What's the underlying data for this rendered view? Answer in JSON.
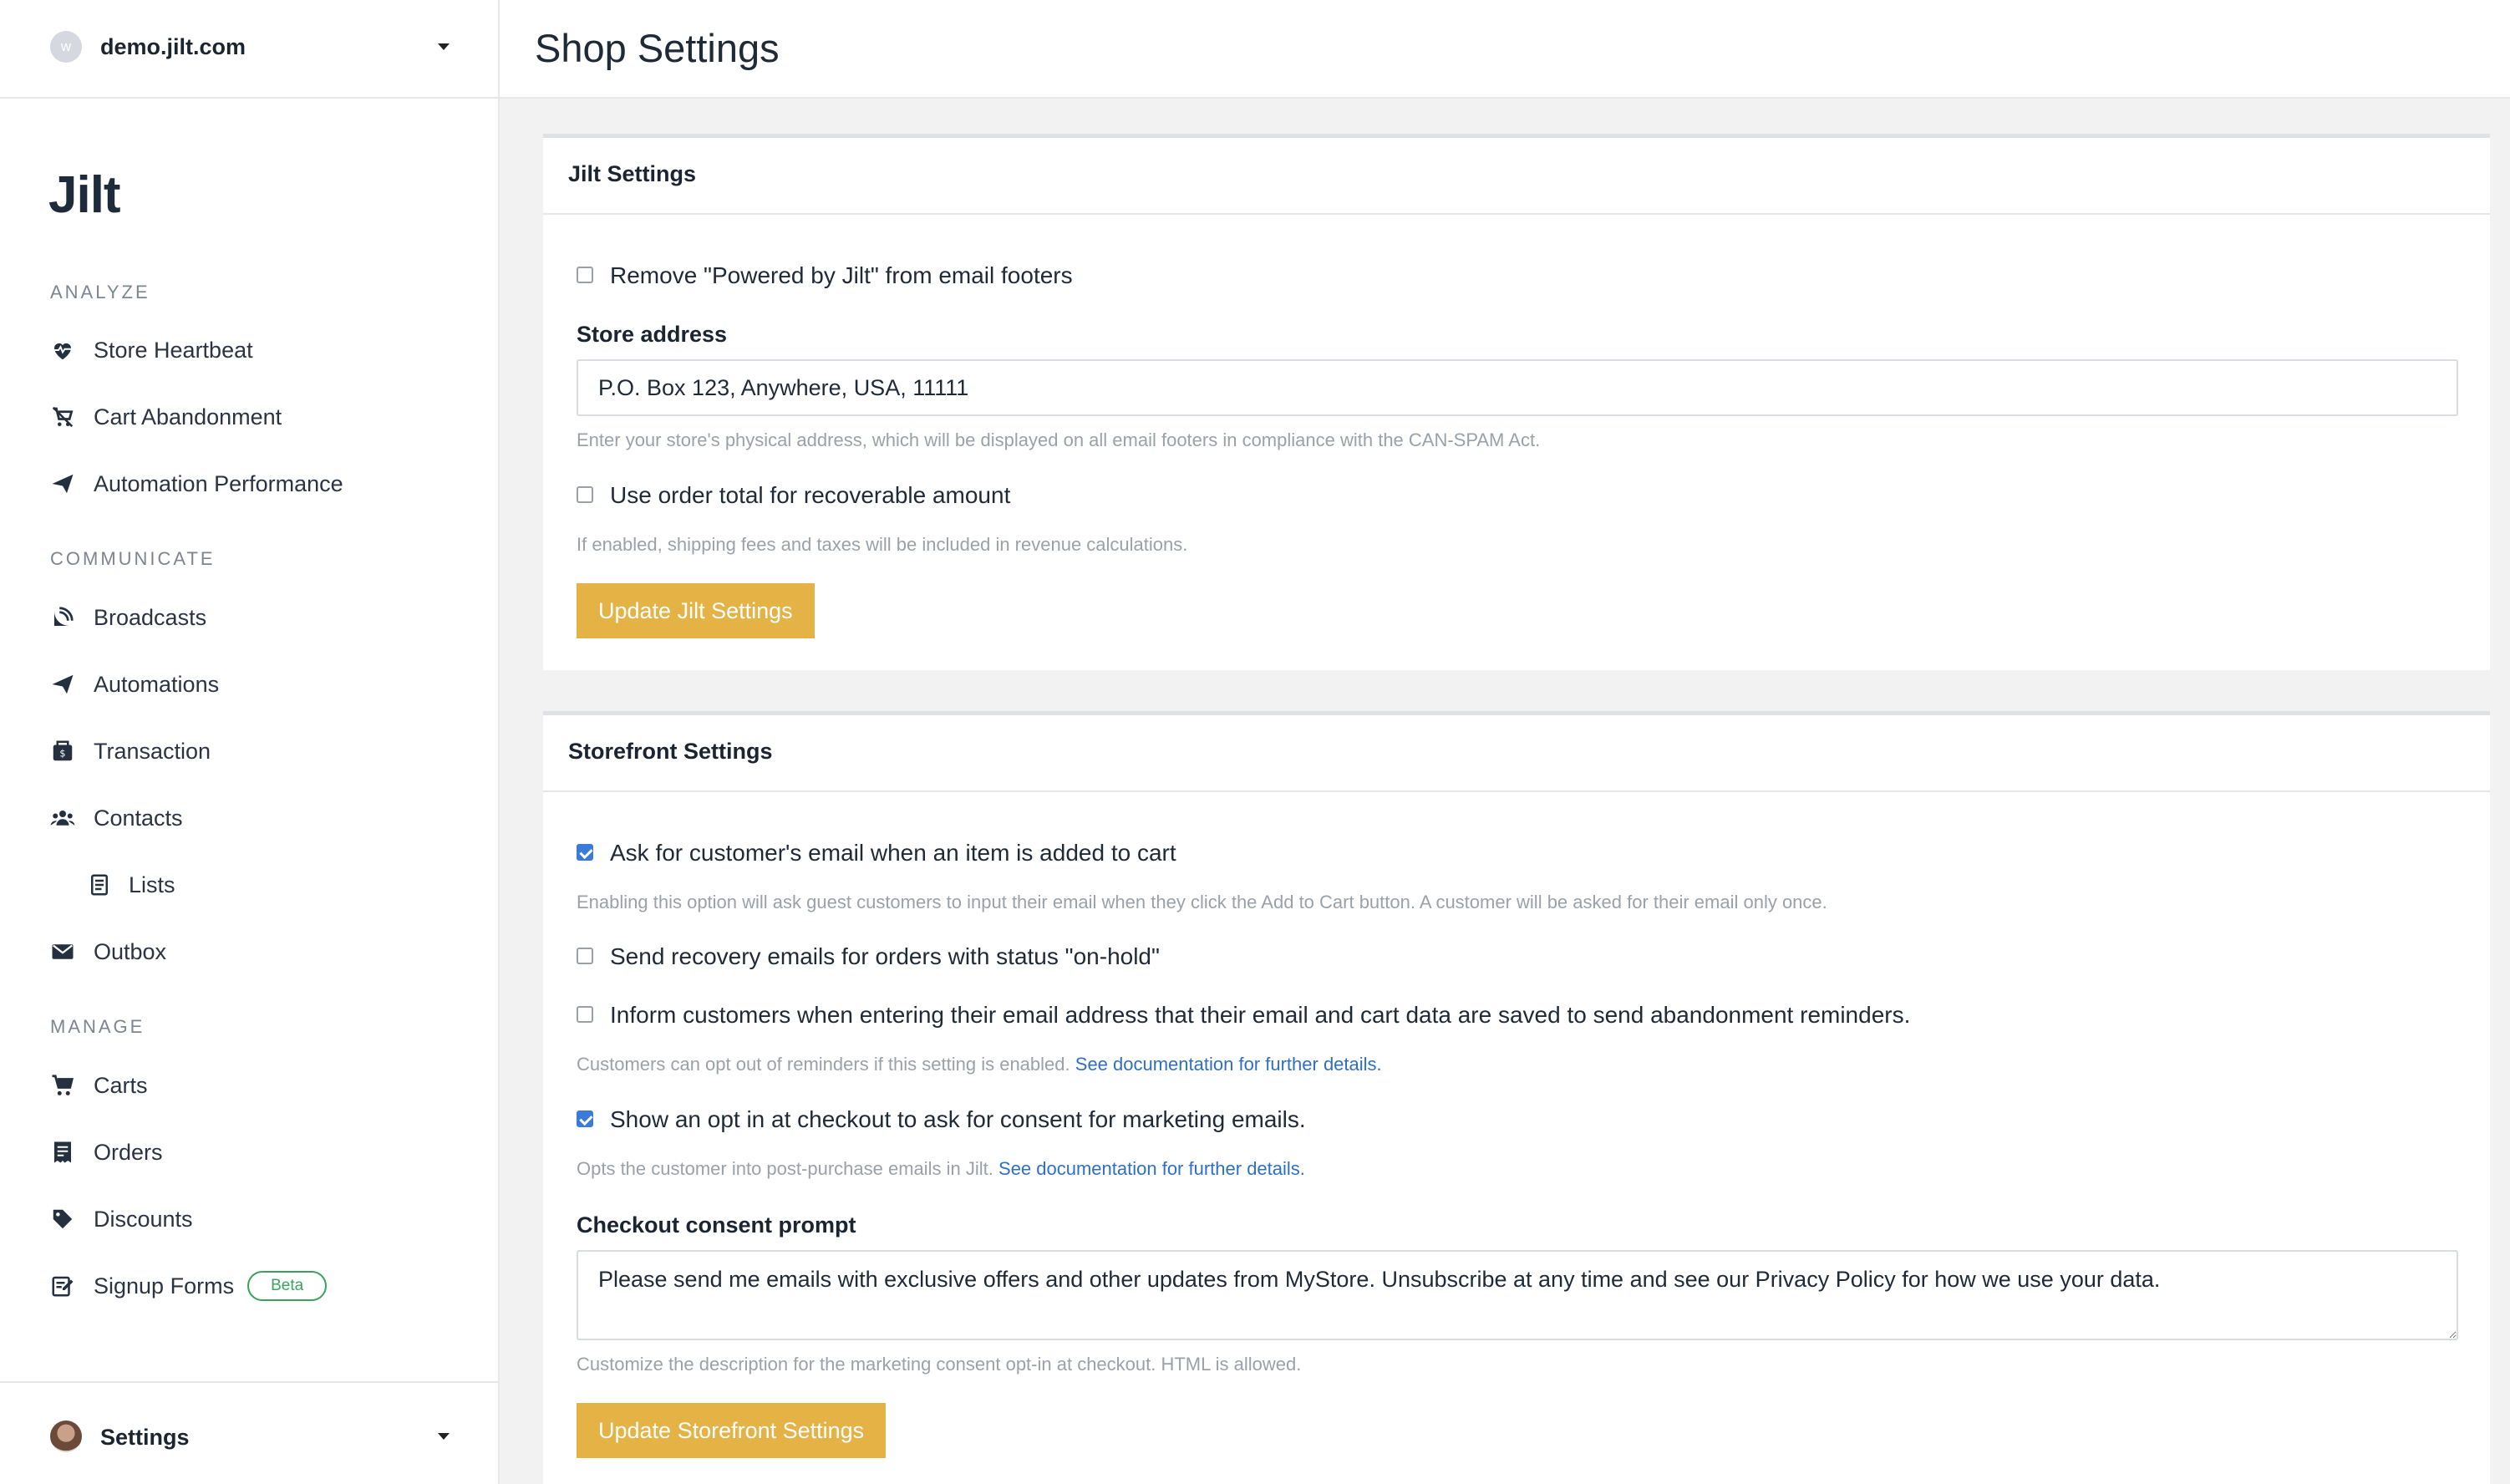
{
  "site": {
    "avatar_letter": "w",
    "name": "demo.jilt.com"
  },
  "logo": "Jilt",
  "sidebar": {
    "sections": {
      "analyze": "ANALYZE",
      "communicate": "COMMUNICATE",
      "manage": "MANAGE"
    },
    "items": {
      "store_heartbeat": "Store Heartbeat",
      "cart_abandonment": "Cart Abandonment",
      "automation_performance": "Automation Performance",
      "broadcasts": "Broadcasts",
      "automations": "Automations",
      "transaction": "Transaction",
      "contacts": "Contacts",
      "lists": "Lists",
      "outbox": "Outbox",
      "carts": "Carts",
      "orders": "Orders",
      "discounts": "Discounts",
      "signup_forms": "Signup Forms",
      "signup_forms_badge": "Beta"
    },
    "footer": {
      "label": "Settings"
    }
  },
  "header": {
    "title": "Shop Settings"
  },
  "jilt_settings": {
    "title": "Jilt Settings",
    "remove_powered_by": {
      "label": "Remove \"Powered by Jilt\" from email footers",
      "checked": false
    },
    "store_address": {
      "label": "Store address",
      "value": "P.O. Box 123, Anywhere, USA, 11111",
      "help": "Enter your store's physical address, which will be displayed on all email footers in compliance with the CAN-SPAM Act."
    },
    "order_total": {
      "label": "Use order total for recoverable amount",
      "checked": false,
      "help": "If enabled, shipping fees and taxes will be included in revenue calculations."
    },
    "button": "Update Jilt Settings"
  },
  "storefront_settings": {
    "title": "Storefront Settings",
    "ask_email": {
      "label": "Ask for customer's email when an item is added to cart",
      "checked": true,
      "help": "Enabling this option will ask guest customers to input their email when they click the Add to Cart button. A customer will be asked for their email only once."
    },
    "on_hold": {
      "label": "Send recovery emails for orders with status \"on-hold\"",
      "checked": false
    },
    "inform_customers": {
      "label": "Inform customers when entering their email address that their email and cart data are saved to send abandonment reminders.",
      "checked": false,
      "help": "Customers can opt out of reminders if this setting is enabled.",
      "help_link": "See documentation for further details."
    },
    "opt_in": {
      "label": "Show an opt in at checkout to ask for consent for marketing emails.",
      "checked": true,
      "help": "Opts the customer into post-purchase emails in Jilt.",
      "help_link": "See documentation for further details."
    },
    "consent_prompt": {
      "label": "Checkout consent prompt",
      "value": "Please send me emails with exclusive offers and other updates from MyStore. Unsubscribe at any time and see our Privacy Policy for how we use your data.",
      "help": "Customize the description for the marketing consent opt-in at checkout. HTML is allowed."
    },
    "button": "Update Storefront Settings"
  },
  "colors": {
    "accent_button": "#e5b245",
    "link": "#2f6fc4",
    "checkbox_checked": "#3c7ad9",
    "beta_badge": "#3aa35b"
  }
}
